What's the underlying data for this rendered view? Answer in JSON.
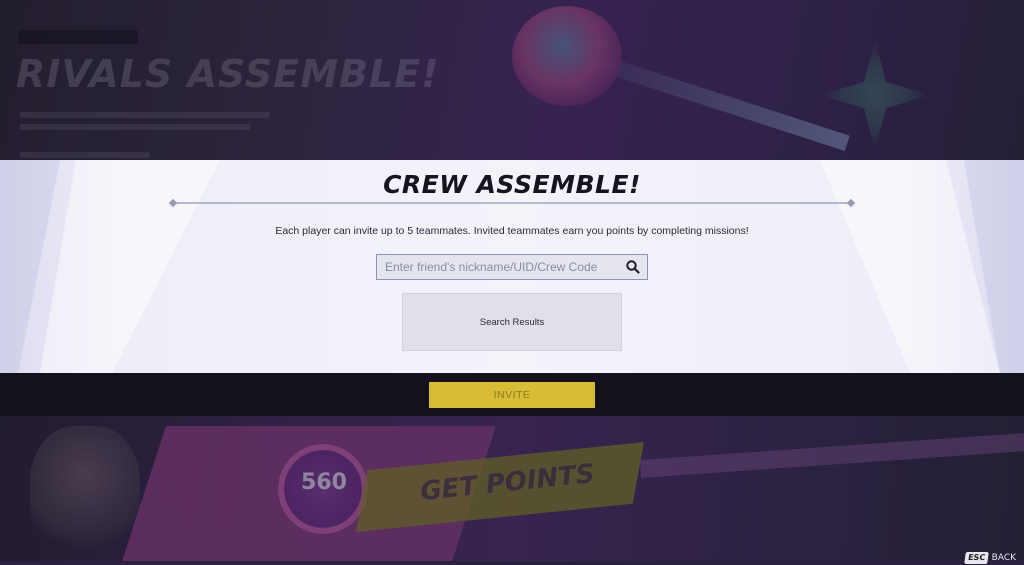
{
  "background": {
    "event_title": "RIVALS ASSEMBLE!",
    "banner_text": "GET POINTS",
    "badge_points": "560"
  },
  "modal": {
    "title": "CREW ASSEMBLE!",
    "description": "Each player can invite up to 5 teammates. Invited teammates earn you points by completing missions!",
    "search": {
      "placeholder": "Enter friend's nickname/UID/Crew Code",
      "value": "",
      "icon": "search-icon"
    },
    "results_label": "Search Results",
    "invite_label": "INVITE"
  },
  "footer": {
    "esc_key": "ESC",
    "back_label": "BACK"
  },
  "colors": {
    "panel_bg": "#f3f3fa",
    "invite_button": "#d6bd35",
    "invite_bar": "#13111a",
    "title_text": "#15151f"
  }
}
